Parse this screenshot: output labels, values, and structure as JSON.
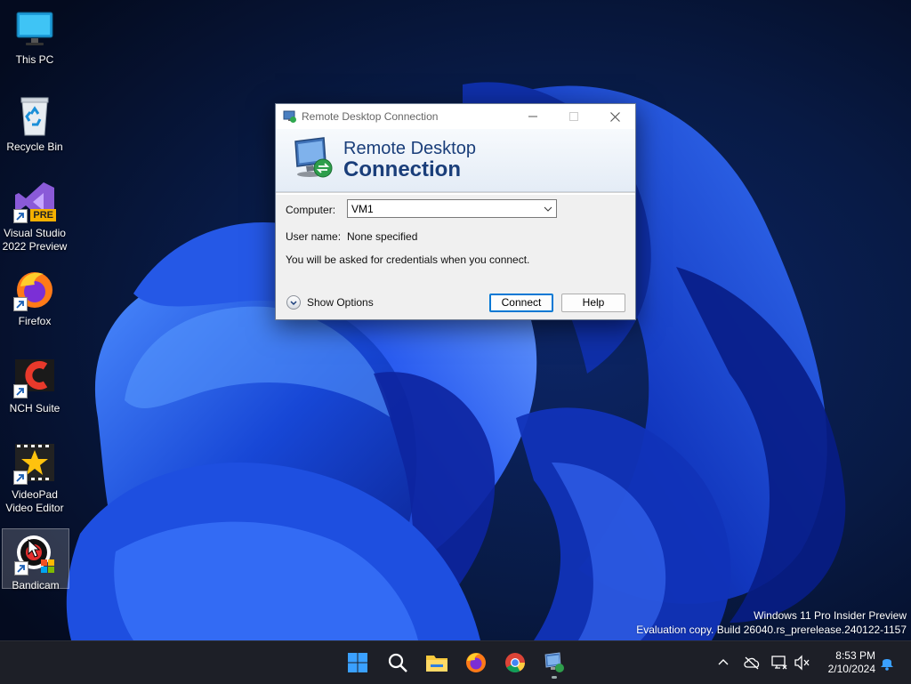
{
  "desktop": {
    "icons": [
      {
        "label": "This PC",
        "icon": "monitor-icon"
      },
      {
        "label": "Recycle Bin",
        "icon": "recycle-bin-icon"
      },
      {
        "label": "Visual Studio 2022 Preview",
        "icon": "visual-studio-icon",
        "badge": "PRE"
      },
      {
        "label": "Firefox",
        "icon": "firefox-icon"
      },
      {
        "label": "NCH Suite",
        "icon": "nch-suite-icon"
      },
      {
        "label": "VideoPad Video Editor",
        "icon": "videopad-icon"
      },
      {
        "label": "Bandicam",
        "icon": "bandicam-icon"
      }
    ],
    "watermark": {
      "line1": "Windows 11 Pro Insider Preview",
      "line2": "Evaluation copy. Build 26040.rs_prerelease.240122-1157"
    }
  },
  "rdc_window": {
    "title": "Remote Desktop Connection",
    "banner_line1": "Remote Desktop",
    "banner_line2": "Connection",
    "computer_label": "Computer:",
    "computer_value": "VM1",
    "username_label": "User name:",
    "username_value": "None specified",
    "info_text": "You will be asked for credentials when you connect.",
    "show_options_label": "Show Options",
    "connect_label": "Connect",
    "help_label": "Help"
  },
  "taskbar": {
    "apps": [
      "start-icon",
      "search-icon",
      "file-explorer-icon",
      "firefox-icon",
      "chrome-icon",
      "remote-desktop-icon"
    ],
    "clock_time": "8:53 PM",
    "clock_date": "2/10/2024"
  },
  "colors": {
    "accent": "#0078d4",
    "banner_text": "#1a3e7a",
    "taskbar": "#1d1f27"
  }
}
